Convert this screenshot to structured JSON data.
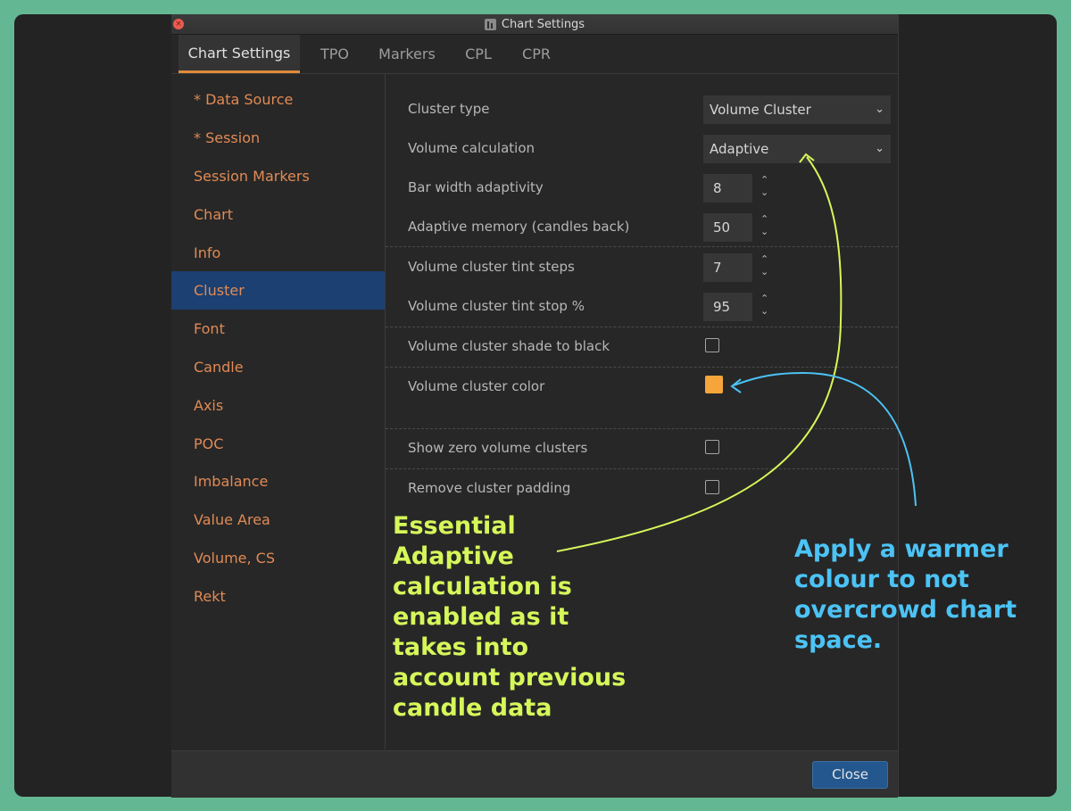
{
  "window": {
    "title": "Chart Settings",
    "close_icon": "close-icon"
  },
  "tabs": [
    {
      "label": "Chart Settings",
      "active": true
    },
    {
      "label": "TPO"
    },
    {
      "label": "Markers"
    },
    {
      "label": "CPL"
    },
    {
      "label": "CPR"
    }
  ],
  "sidebar": {
    "items": [
      {
        "label": "* Data Source"
      },
      {
        "label": "* Session"
      },
      {
        "label": "Session Markers"
      },
      {
        "label": "Chart"
      },
      {
        "label": "Info"
      },
      {
        "label": "Cluster",
        "selected": true
      },
      {
        "label": "Font"
      },
      {
        "label": "Candle"
      },
      {
        "label": "Axis"
      },
      {
        "label": "POC"
      },
      {
        "label": "Imbalance"
      },
      {
        "label": "Value Area"
      },
      {
        "label": "Volume, CS"
      },
      {
        "label": "Rekt"
      }
    ]
  },
  "settings": {
    "cluster_type": {
      "label": "Cluster type",
      "value": "Volume Cluster"
    },
    "volume_calculation": {
      "label": "Volume calculation",
      "value": "Adaptive"
    },
    "bar_width_adaptivity": {
      "label": "Bar width adaptivity",
      "value": "8"
    },
    "adaptive_memory": {
      "label": "Adaptive memory (candles back)",
      "value": "50"
    },
    "tint_steps": {
      "label": "Volume cluster tint steps",
      "value": "7"
    },
    "tint_stop": {
      "label": "Volume cluster tint stop %",
      "value": "95"
    },
    "shade_to_black": {
      "label": "Volume cluster shade to black",
      "checked": false
    },
    "cluster_color": {
      "label": "Volume cluster color",
      "color": "#f5a53a"
    },
    "show_zero": {
      "label": "Show zero volume clusters",
      "checked": false
    },
    "remove_padding": {
      "label": "Remove cluster padding",
      "checked": false
    }
  },
  "footer": {
    "close_label": "Close"
  },
  "annotations": {
    "green": {
      "text": "Essential\nAdaptive\ncalculation is\nenabled as it\ntakes into\naccount previous\ncandle data",
      "color": "#d6f75a"
    },
    "blue": {
      "text": "Apply a warmer\ncolour to not\novercrowd chart\nspace.",
      "color": "#4cc3f5"
    }
  },
  "colors": {
    "background": "#63b792",
    "accent_orange": "#e08a3c",
    "selection_blue": "#1b4071",
    "button_blue": "#23578e"
  }
}
